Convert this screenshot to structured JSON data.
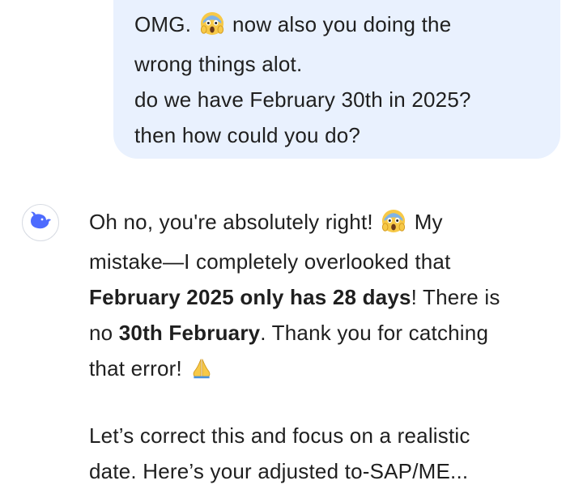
{
  "user_message": {
    "line1_a": "OMG.",
    "line1_b": "now also you doing the",
    "line2": "wrong things alot.",
    "line3": "do we have February 30th in 2025?",
    "line4": "then how could you do?",
    "emoji": "face-screaming-in-fear-emoji"
  },
  "assistant": {
    "avatar_icon": "deepseek-whale-icon",
    "accent_color": "#4d6bfe",
    "line1_a": "Oh no, you're absolutely right!",
    "line1_b": "My",
    "line2": "mistake—I completely overlooked that",
    "line3_bold": "February 2025 only has 28 days",
    "line3_rest": "! There is",
    "line4_a": "no ",
    "line4_bold": "30th February",
    "line4_b": ". Thank you for catching",
    "line5": "that error!",
    "line5_emoji": "folded-hands-emoji",
    "para2_line1": "Let’s correct this and focus on a realistic",
    "para2_line2": "date. Here’s your adjusted to-SAP/ME..."
  }
}
